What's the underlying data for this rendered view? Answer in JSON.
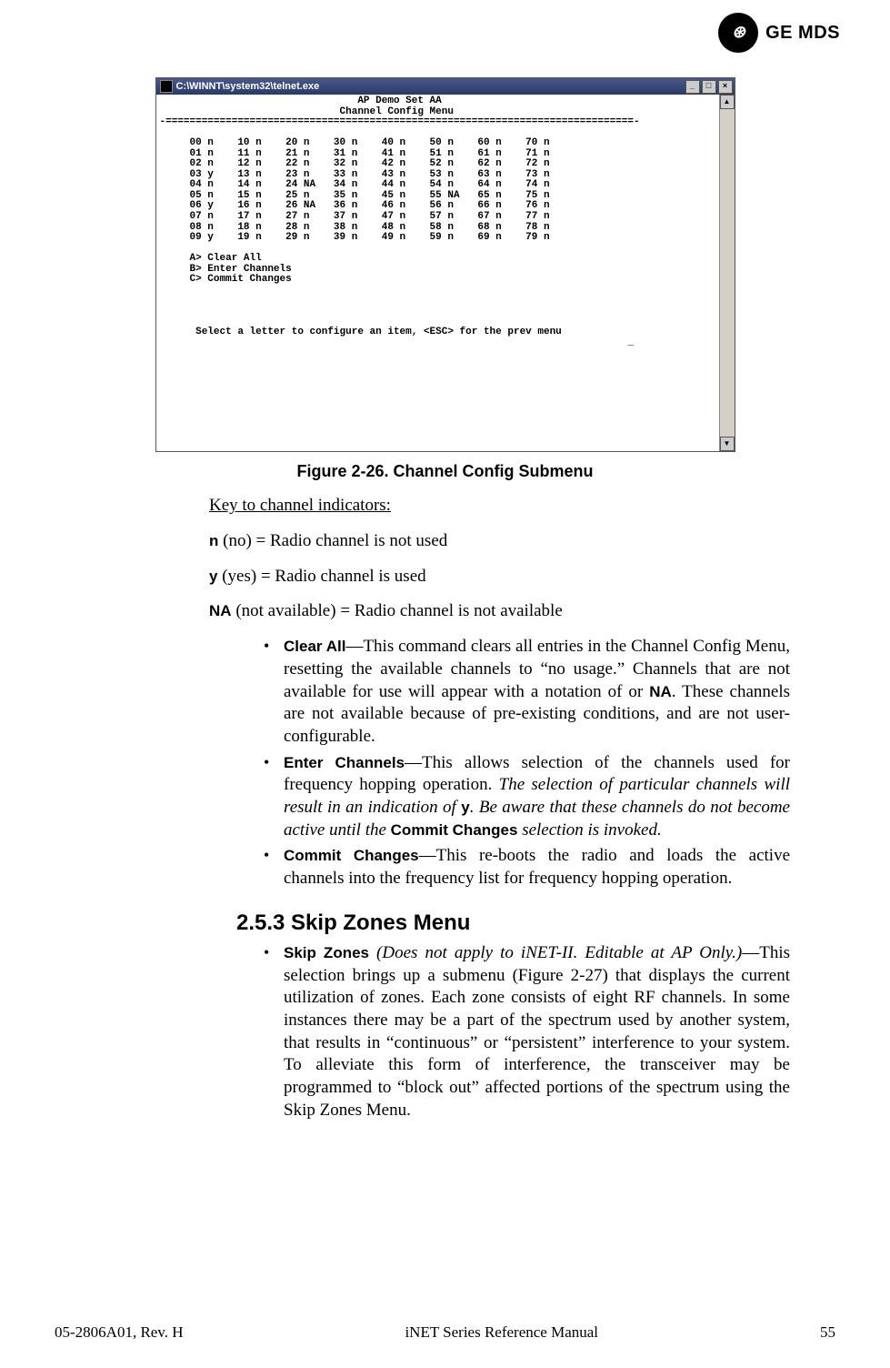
{
  "logo": {
    "monogram": "⊛",
    "brand": "GE MDS"
  },
  "telnet": {
    "title": "C:\\WINNT\\system32\\telnet.exe",
    "header1": "AP Demo Set AA",
    "header2": "Channel Config Menu",
    "rule": "-==============================================================================-",
    "grid": [
      [
        "00 n",
        "10 n",
        "20 n",
        "30 n",
        "40 n",
        "50 n",
        "60 n",
        "70 n"
      ],
      [
        "01 n",
        "11 n",
        "21 n",
        "31 n",
        "41 n",
        "51 n",
        "61 n",
        "71 n"
      ],
      [
        "02 n",
        "12 n",
        "22 n",
        "32 n",
        "42 n",
        "52 n",
        "62 n",
        "72 n"
      ],
      [
        "03 y",
        "13 n",
        "23 n",
        "33 n",
        "43 n",
        "53 n",
        "63 n",
        "73 n"
      ],
      [
        "04 n",
        "14 n",
        "24 NA",
        "34 n",
        "44 n",
        "54 n",
        "64 n",
        "74 n"
      ],
      [
        "05 n",
        "15 n",
        "25 n",
        "35 n",
        "45 n",
        "55 NA",
        "65 n",
        "75 n"
      ],
      [
        "06 y",
        "16 n",
        "26 NA",
        "36 n",
        "46 n",
        "56 n",
        "66 n",
        "76 n"
      ],
      [
        "07 n",
        "17 n",
        "27 n",
        "37 n",
        "47 n",
        "57 n",
        "67 n",
        "77 n"
      ],
      [
        "08 n",
        "18 n",
        "28 n",
        "38 n",
        "48 n",
        "58 n",
        "68 n",
        "78 n"
      ],
      [
        "09 y",
        "19 n",
        "29 n",
        "39 n",
        "49 n",
        "59 n",
        "69 n",
        "79 n"
      ]
    ],
    "menuA": "A> Clear All",
    "menuB": "B> Enter Channels",
    "menuC": "C> Commit Changes",
    "prompt": "Select a letter to configure an item, <ESC> for the prev menu"
  },
  "figureCaption": "Figure 2-26. Channel Config Submenu",
  "keyHeading": "Key to channel indicators:",
  "keys": {
    "n_code": "n",
    "n_text": " (no) = Radio channel is not used",
    "y_code": "y",
    "y_text": " (yes) = Radio channel is used",
    "na_code": "NA",
    "na_text": " (not available) = Radio channel is not available"
  },
  "bullets": {
    "clearAll_label": "Clear All",
    "clearAll_body": "—This command clears all entries in the Channel Config Menu, resetting the available channels to “no usage.” Channels that are not available for use will appear with a notation of or ",
    "clearAll_na": "NA",
    "clearAll_tail": ". These channels are not available because of pre-existing conditions, and are not user-configurable.",
    "enter_label": "Enter Channels",
    "enter_body1": "—This allows selection of the channels used for frequency hopping operation. ",
    "enter_ital1": "The selection of particular channels will result in an indication of ",
    "enter_y": "y",
    "enter_ital2": ". Be aware that these channels do not become active until the ",
    "enter_commit": "Commit Changes",
    "enter_ital3": " selection is invoked.",
    "commit_label": "Commit Changes",
    "commit_body": "—This re-boots the radio and loads the active channels into the frequency list for frequency hopping operation."
  },
  "section": {
    "number_title": "2.5.3 Skip Zones Menu",
    "skip_label": "Skip Zones",
    "skip_ital": " (Does not apply to iNET-II. Editable at AP Only.)",
    "skip_body": "—This selection brings up a submenu (Figure 2-27) that displays the current utilization of zones. Each zone consists of eight RF channels. In some instances there may be a part of the spectrum used by another system, that results in “continuous” or “persistent” interference to your system. To alleviate this form of interference, the transceiver may be programmed to “block out” affected portions of the spectrum using the Skip Zones Menu."
  },
  "footer": {
    "left": "05-2806A01, Rev. H",
    "center": "iNET Series Reference Manual",
    "right": "55"
  }
}
